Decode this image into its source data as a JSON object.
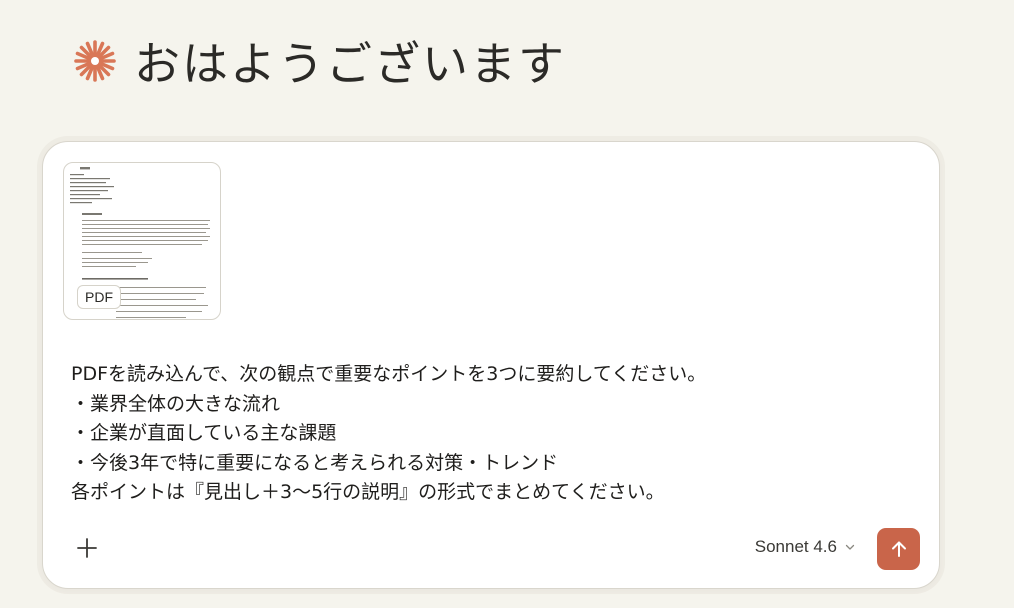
{
  "greeting": {
    "text": "おはようございます",
    "icon": "claude-asterisk-icon"
  },
  "composer": {
    "attachment": {
      "type_label": "PDF",
      "icon": "pdf-document-thumbnail"
    },
    "prompt_lines": [
      "PDFを読み込んで、次の観点で重要なポイントを3つに要約してください。",
      "・業界全体の大きな流れ",
      "・企業が直面している主な課題",
      "・今後3年で特に重要になると考えられる対策・トレンド",
      "各ポイントは『見出し＋3〜5行の説明』の形式でまとめてください。"
    ],
    "model": "Sonnet 4.6",
    "add_icon": "plus-icon",
    "send_icon": "arrow-up-icon"
  },
  "colors": {
    "background": "#f5f4ed",
    "accent": "#c9654a",
    "logo": "#d97757",
    "card": "#ffffff"
  }
}
